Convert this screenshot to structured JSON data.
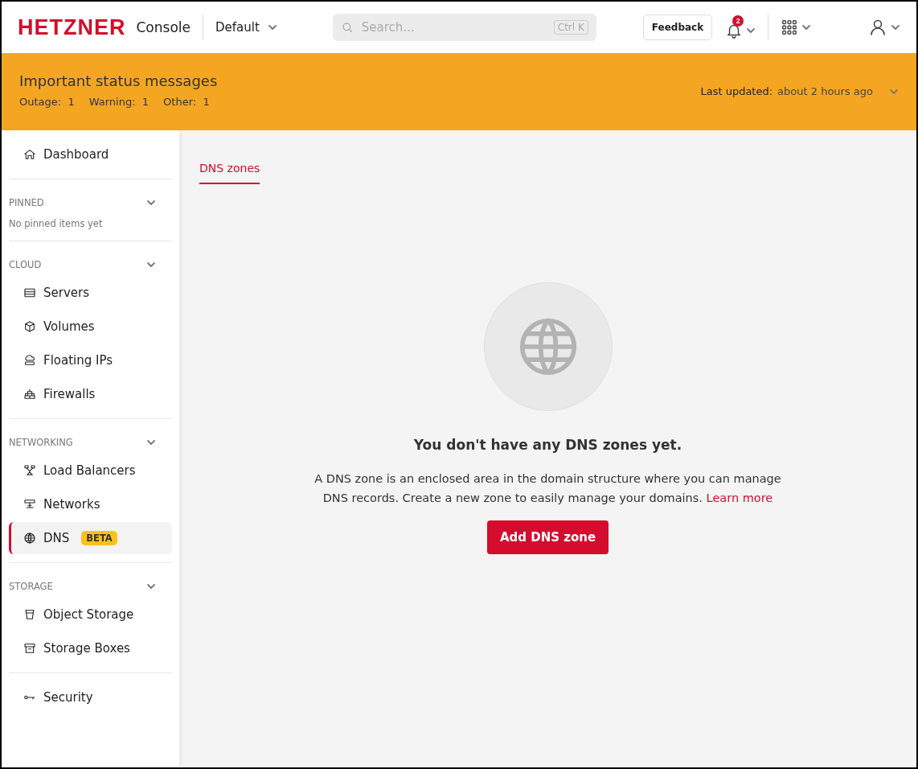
{
  "header": {
    "logo": "HETZNER",
    "product": "Console",
    "project": "Default",
    "search": {
      "placeholder": "Search...",
      "shortcut": "Ctrl K"
    },
    "feedback": "Feedback",
    "notification_count": "2"
  },
  "status_banner": {
    "title": "Important status messages",
    "counts": [
      {
        "label": "Outage:",
        "value": "1"
      },
      {
        "label": "Warning:",
        "value": "1"
      },
      {
        "label": "Other:",
        "value": "1"
      }
    ],
    "last_updated_label": "Last updated:",
    "last_updated": "about 2 hours ago"
  },
  "sidebar": {
    "groups": [
      {
        "items": [
          {
            "label": "Dashboard",
            "selected": false
          }
        ]
      },
      {
        "title": "PINNED",
        "expanded": true,
        "empty_text": "No pinned items yet"
      },
      {
        "title": "CLOUD",
        "expanded": true,
        "items": [
          {
            "label": "Servers",
            "selected": false
          },
          {
            "label": "Volumes",
            "selected": false
          },
          {
            "label": "Floating IPs",
            "selected": false
          },
          {
            "label": "Firewalls",
            "selected": false
          }
        ]
      },
      {
        "title": "NETWORKING",
        "expanded": true,
        "items": [
          {
            "label": "Load Balancers",
            "selected": false
          },
          {
            "label": "Networks",
            "selected": false
          },
          {
            "label": "DNS",
            "selected": true,
            "badge": "BETA"
          }
        ]
      },
      {
        "title": "STORAGE",
        "expanded": true,
        "items": [
          {
            "label": "Object Storage",
            "selected": false
          },
          {
            "label": "Storage Boxes",
            "selected": false
          }
        ]
      },
      {
        "items": [
          {
            "label": "Security",
            "selected": false
          }
        ]
      }
    ]
  },
  "tabs": [
    {
      "label": "DNS zones",
      "selected": true
    }
  ],
  "empty_state": {
    "title": "You don't have any DNS zones yet.",
    "text": "A DNS zone is an enclosed area in the domain structure where you can manage DNS records. Create a new zone to easily manage your domains.",
    "link": "Learn more",
    "button": "Add DNS zone"
  }
}
